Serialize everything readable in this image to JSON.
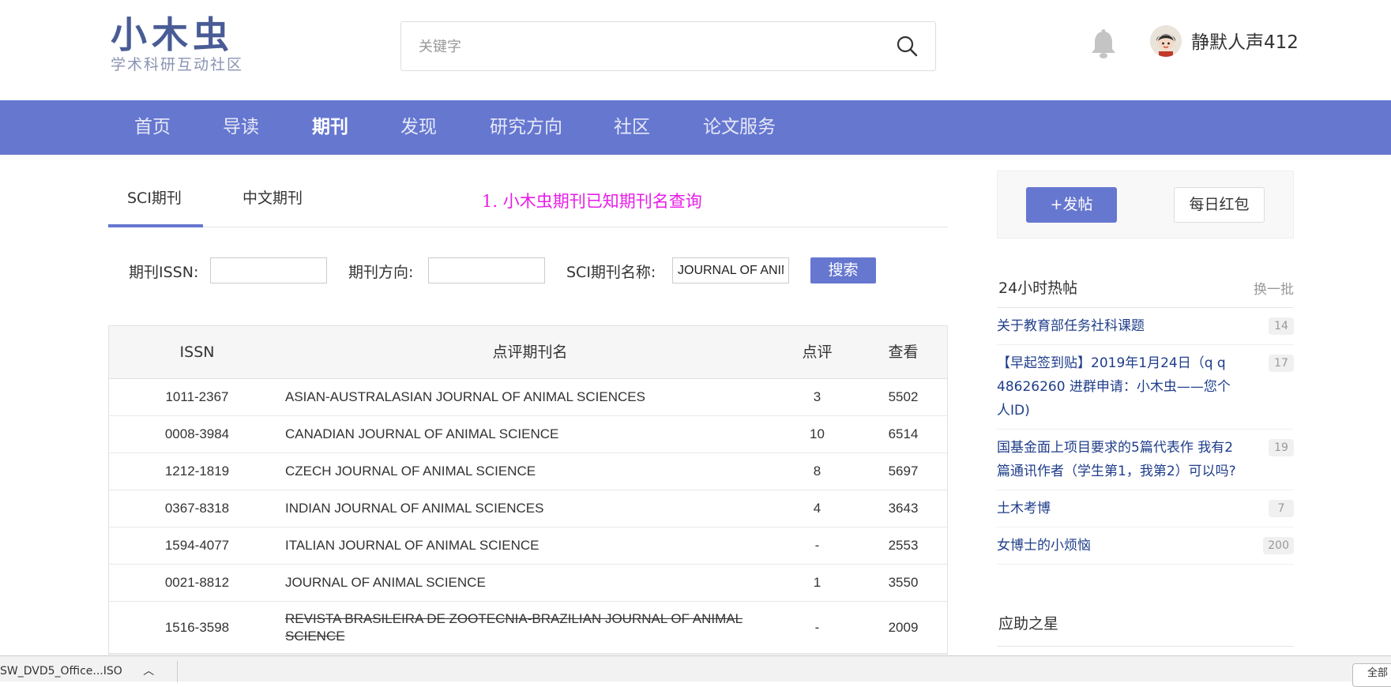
{
  "header": {
    "logo_main": "小木虫",
    "logo_sub": "学术科研互动社区",
    "search_placeholder": "关键字",
    "username": "静默人声412"
  },
  "nav": {
    "items": [
      "首页",
      "导读",
      "期刊",
      "发现",
      "研究方向",
      "社区",
      "论文服务"
    ],
    "active_index": 2
  },
  "tabs": [
    "SCI期刊",
    "中文期刊"
  ],
  "notice": "1.  小木虫期刊已知期刊名查询",
  "filters": {
    "issn_label": "期刊ISSN:",
    "issn_value": "",
    "direction_label": "期刊方向:",
    "direction_value": "",
    "name_label": "SCI期刊名称:",
    "name_value": "JOURNAL OF ANIMAL SCIENCE",
    "search_button": "搜索"
  },
  "table": {
    "headers": [
      "ISSN",
      "点评期刊名",
      "点评",
      "查看"
    ],
    "rows": [
      {
        "issn": "1011-2367",
        "name": "ASIAN-AUSTRALASIAN JOURNAL OF ANIMAL SCIENCES",
        "reviews": "3",
        "views": "5502",
        "strike": false
      },
      {
        "issn": "0008-3984",
        "name": "CANADIAN JOURNAL OF ANIMAL SCIENCE",
        "reviews": "10",
        "views": "6514",
        "strike": false
      },
      {
        "issn": "1212-1819",
        "name": "CZECH JOURNAL OF ANIMAL SCIENCE",
        "reviews": "8",
        "views": "5697",
        "strike": false
      },
      {
        "issn": "0367-8318",
        "name": "INDIAN JOURNAL OF ANIMAL SCIENCES",
        "reviews": "4",
        "views": "3643",
        "strike": false
      },
      {
        "issn": "1594-4077",
        "name": "ITALIAN JOURNAL OF ANIMAL SCIENCE",
        "reviews": "-",
        "views": "2553",
        "strike": false
      },
      {
        "issn": "0021-8812",
        "name": "JOURNAL OF ANIMAL SCIENCE",
        "reviews": "1",
        "views": "3550",
        "strike": false
      },
      {
        "issn": "1516-3598",
        "name": "REVISTA BRASILEIRA DE ZOOTECNIA-BRAZILIAN JOURNAL OF ANIMAL SCIENCE",
        "reviews": "-",
        "views": "2009",
        "strike": true
      }
    ]
  },
  "sidebar": {
    "post_button": "+发帖",
    "red_packet_button": "每日红包",
    "hot_title": "24小时热帖",
    "hot_more": "换一批",
    "hot_items": [
      {
        "title": "关于教育部任务社科课题",
        "count": "14"
      },
      {
        "title": "【早起签到贴】2019年1月24日（q q 48626260 进群申请：小木虫——您个人ID)",
        "count": "17"
      },
      {
        "title": "国基金面上项目要求的5篇代表作 我有2篇通讯作者（学生第1，我第2）可以吗?",
        "count": "19"
      },
      {
        "title": "土木考博",
        "count": "7"
      },
      {
        "title": "女博士的小烦恼",
        "count": "200"
      }
    ],
    "helper_title": "应助之星"
  },
  "download_bar": {
    "file": "SW_DVD5_Office...ISO",
    "right_label": "全部"
  },
  "colors": {
    "nav_bg": "#6677d0",
    "link": "#1f3d8a",
    "notice": "#e81ce8"
  }
}
